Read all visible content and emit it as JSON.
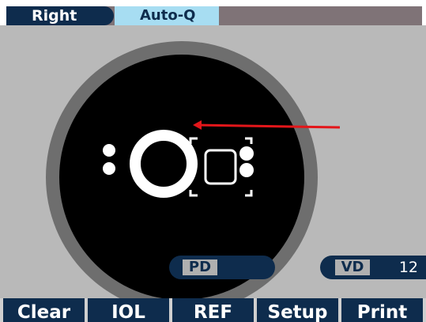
{
  "header": {
    "eye_tab": "Right",
    "mode_tab": "Auto-Q"
  },
  "viewer": {
    "pd": {
      "label": "PD",
      "value": ""
    },
    "vd": {
      "label": "VD",
      "value": "12"
    }
  },
  "bottom_bar": {
    "buttons": [
      "Clear",
      "IOL",
      "REF",
      "Setup",
      "Print"
    ]
  },
  "colors": {
    "accent": "#0e2c4d",
    "tab_highlight": "#a7ddf2",
    "indicator": "#e3161a"
  }
}
